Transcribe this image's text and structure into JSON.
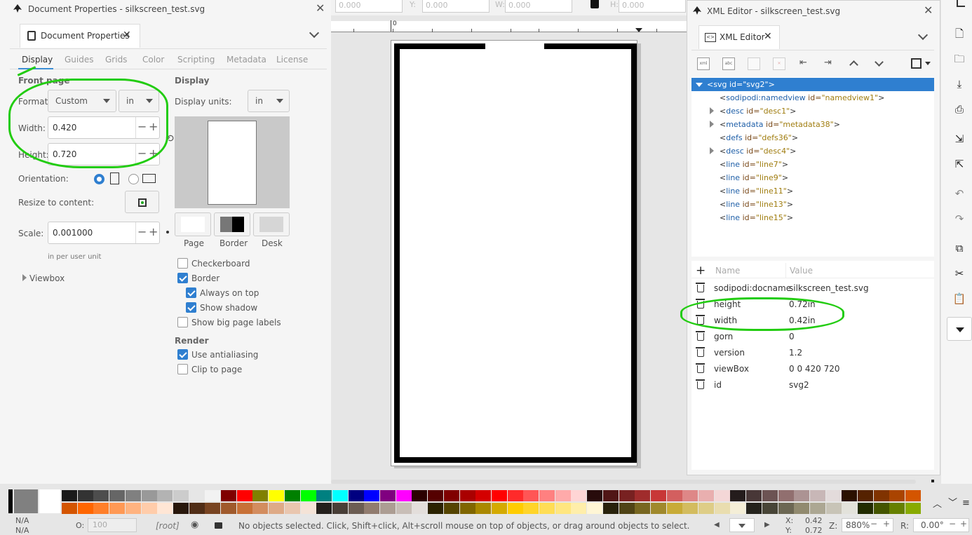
{
  "colors": {
    "accent": "#3b8ed4",
    "annotation": "#22cc11",
    "checkbox": "#2f7fd0"
  },
  "toolbar_top": {
    "x_value": "0.000",
    "y_label": "Y:",
    "y_value": "0.000",
    "w_label": "W:",
    "w_value": "0.000",
    "h_label": "H:",
    "h_value": "0.000"
  },
  "canvas": {
    "ruler_zero": "0"
  },
  "doc_props": {
    "window_title": "Document Properties - silkscreen_test.svg",
    "tab_label": "Document Properties",
    "subtabs": [
      "Display",
      "Guides",
      "Grids",
      "Color",
      "Scripting",
      "Metadata",
      "License"
    ],
    "front_page_heading": "Front page",
    "format_label": "Format:",
    "format_value": "Custom",
    "format_unit": "in",
    "width_label": "Width:",
    "width_value": "0.420",
    "height_label": "Height:",
    "height_value": "0.720",
    "orientation_label": "Orientation:",
    "resize_label": "Resize to content:",
    "scale_label": "Scale:",
    "scale_value": "0.001000",
    "scale_hint": "in  per user unit",
    "viewbox_label": "Viewbox",
    "display_heading": "Display",
    "display_units_label": "Display units:",
    "display_units_value": "in",
    "swatch_labels": [
      "Page",
      "Border",
      "Desk"
    ],
    "checkboxes": [
      {
        "label": "Checkerboard",
        "checked": false
      },
      {
        "label": "Border",
        "checked": true
      },
      {
        "label": "Always on top",
        "checked": true
      },
      {
        "label": "Show shadow",
        "checked": true
      },
      {
        "label": "Show big page labels",
        "checked": false
      }
    ],
    "render_heading": "Render",
    "render_checkboxes": [
      {
        "label": "Use antialiasing",
        "checked": true
      },
      {
        "label": "Clip to page",
        "checked": false
      }
    ]
  },
  "xml_editor": {
    "window_title": "XML Editor - silkscreen_test.svg",
    "tab_label": "XML Editor",
    "tree": [
      {
        "open": "<",
        "tag": "svg",
        "attr": " id=",
        "val": "\"svg2\"",
        "close": ">",
        "level": 0,
        "expander": "open",
        "selected": true
      },
      {
        "open": "<",
        "tag": "sodipodi:namedview",
        "attr": " id=",
        "val": "\"namedview1\"",
        "close": ">",
        "level": 1,
        "expander": "none"
      },
      {
        "open": "<",
        "tag": "desc",
        "attr": " id=",
        "val": "\"desc1\"",
        "close": ">",
        "level": 1,
        "expander": "closed"
      },
      {
        "open": "<",
        "tag": "metadata",
        "attr": " id=",
        "val": "\"metadata38\"",
        "close": ">",
        "level": 1,
        "expander": "closed"
      },
      {
        "open": "<",
        "tag": "defs",
        "attr": " id=",
        "val": "\"defs36\"",
        "close": ">",
        "level": 1,
        "expander": "none"
      },
      {
        "open": "<",
        "tag": "desc",
        "attr": " id=",
        "val": "\"desc4\"",
        "close": ">",
        "level": 1,
        "expander": "closed"
      },
      {
        "open": "<",
        "tag": "line",
        "attr": " id=",
        "val": "\"line7\"",
        "close": ">",
        "level": 1,
        "expander": "none"
      },
      {
        "open": "<",
        "tag": "line",
        "attr": " id=",
        "val": "\"line9\"",
        "close": ">",
        "level": 1,
        "expander": "none"
      },
      {
        "open": "<",
        "tag": "line",
        "attr": " id=",
        "val": "\"line11\"",
        "close": ">",
        "level": 1,
        "expander": "none"
      },
      {
        "open": "<",
        "tag": "line",
        "attr": " id=",
        "val": "\"line13\"",
        "close": ">",
        "level": 1,
        "expander": "none"
      },
      {
        "open": "<",
        "tag": "line",
        "attr": " id=",
        "val": "\"line15\"",
        "close": ">",
        "level": 1,
        "expander": "none"
      }
    ],
    "attr_header": {
      "add": "+",
      "name": "Name",
      "value": "Value"
    },
    "attributes": [
      {
        "name": "sodipodi:docname",
        "value": "silkscreen_test.svg"
      },
      {
        "name": "height",
        "value": "0.72in"
      },
      {
        "name": "width",
        "value": "0.42in"
      },
      {
        "name": "gorn",
        "value": "0"
      },
      {
        "name": "version",
        "value": "1.2"
      },
      {
        "name": "viewBox",
        "value": "0 0 420 720"
      },
      {
        "name": "id",
        "value": "svg2"
      }
    ]
  },
  "statusbar": {
    "fill": "N/A",
    "stroke": "N/A",
    "opacity_label": "O:",
    "opacity_value": "100",
    "layer": "[root]",
    "message": "No objects selected. Click, Shift+click, Alt+scroll mouse on top of objects, or drag around objects to select.",
    "x_label": "X:",
    "x_value": "0.42",
    "y_label": "Y:",
    "y_value": "0.72",
    "zoom_label": "Z:",
    "zoom_value": "880%",
    "rot_label": "R:",
    "rot_value": "0.00°"
  },
  "palette": {
    "row1": [
      "#1a1a1a",
      "#333333",
      "#4d4d4d",
      "#666666",
      "#808080",
      "#999999",
      "#b3b3b3",
      "#cccccc",
      "#e6e6e6",
      "#f2f2f2",
      "#800000",
      "#ff0000",
      "#808000",
      "#ffff00",
      "#008000",
      "#00ff00",
      "#008080",
      "#00ffff",
      "#000080",
      "#0000ff",
      "#800080",
      "#ff00ff",
      "#2b0000",
      "#550000",
      "#800000",
      "#aa0000",
      "#d40000",
      "#ff0000",
      "#ff2a2a",
      "#ff5555",
      "#ff8080",
      "#ffaaaa",
      "#ffd5d5",
      "#280b0b",
      "#501616",
      "#782121",
      "#a02c2c",
      "#c83737",
      "#d35f5f",
      "#de8787",
      "#e9afaf",
      "#f4d7d7",
      "#241c1c",
      "#483737",
      "#6c5353",
      "#916f6f",
      "#ac9393",
      "#c8b7b7",
      "#e3dbdb",
      "#2b1100",
      "#552200",
      "#803300",
      "#aa4400",
      "#d45500"
    ],
    "row2": [
      "#d45500",
      "#ff6600",
      "#ff7f2a",
      "#ff9955",
      "#ffb380",
      "#ffccaa",
      "#ffe6d5",
      "#28170b",
      "#502d16",
      "#784421",
      "#a05a2c",
      "#c87137",
      "#d38d5f",
      "#deaa87",
      "#e9c6af",
      "#f4e3d7",
      "#241f1c",
      "#483e37",
      "#6c5d53",
      "#917c6f",
      "#ac9d93",
      "#c8beb7",
      "#e3dedb",
      "#2b2200",
      "#554400",
      "#806600",
      "#aa8800",
      "#d4aa00",
      "#ffcc00",
      "#ffd42a",
      "#ffdd55",
      "#ffe680",
      "#ffeeaa",
      "#fff6d5",
      "#28220b",
      "#504416",
      "#786721",
      "#a0892c",
      "#c8ab37",
      "#d3bc5f",
      "#decd87",
      "#e9ddaf",
      "#f4eed7",
      "#24221c",
      "#484537",
      "#6c6753",
      "#918a6f",
      "#aca793",
      "#c8c4b7",
      "#e3e2db",
      "#222b00",
      "#445500",
      "#668000",
      "#88aa00"
    ]
  }
}
